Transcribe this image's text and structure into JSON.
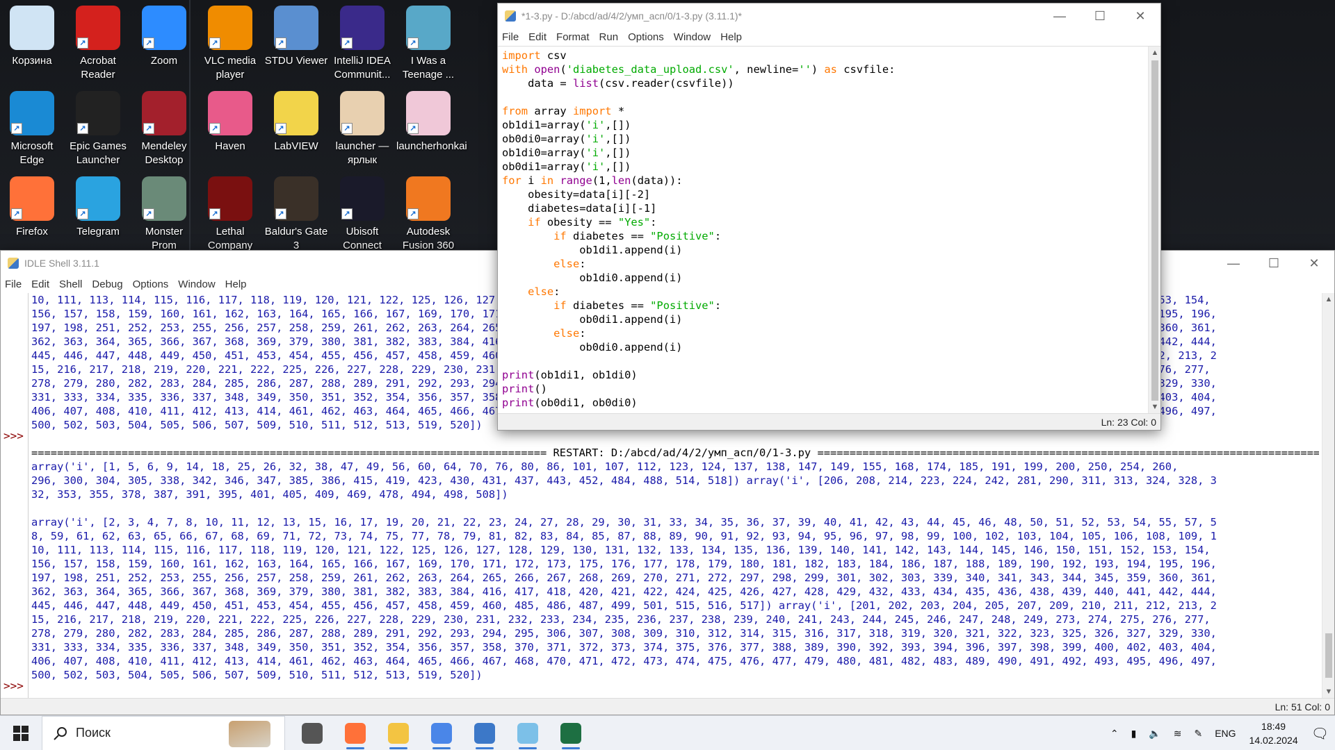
{
  "desktop": {
    "icons": [
      {
        "label": "Корзина",
        "icon": "recycle-bin-icon",
        "color": "#d0e4f4"
      },
      {
        "label": "Acrobat Reader",
        "icon": "acrobat-icon",
        "color": "#d4211d"
      },
      {
        "label": "Zoom",
        "icon": "zoom-icon",
        "color": "#2d8cff"
      },
      {
        "label": "VLC media player",
        "icon": "vlc-icon",
        "color": "#f08c00"
      },
      {
        "label": "STDU Viewer",
        "icon": "stdu-icon",
        "color": "#5a8fd0"
      },
      {
        "label": "IntelliJ IDEA Communit...",
        "icon": "intellij-icon",
        "color": "#3a2a8a"
      },
      {
        "label": "I Was a Teenage ...",
        "icon": "game-icon",
        "color": "#58a8c8"
      },
      {
        "label": "Microsoft Edge",
        "icon": "edge-icon",
        "color": "#1a8ad4"
      },
      {
        "label": "Epic Games Launcher",
        "icon": "epic-icon",
        "color": "#222222"
      },
      {
        "label": "Mendeley Desktop",
        "icon": "mendeley-icon",
        "color": "#a3202c"
      },
      {
        "label": "Haven",
        "icon": "haven-icon",
        "color": "#e85a8a"
      },
      {
        "label": "LabVIEW",
        "icon": "labview-icon",
        "color": "#f2d44a"
      },
      {
        "label": "launcher — ярлык",
        "icon": "genshin-icon",
        "color": "#e8d0b0"
      },
      {
        "label": "launcherhonkai",
        "icon": "honkai-icon",
        "color": "#f0c8d8"
      },
      {
        "label": "Firefox",
        "icon": "firefox-icon",
        "color": "#ff7139"
      },
      {
        "label": "Telegram",
        "icon": "telegram-icon",
        "color": "#2aa3e0"
      },
      {
        "label": "Monster Prom",
        "icon": "monster-prom-icon",
        "color": "#6a8a78"
      },
      {
        "label": "Lethal Company",
        "icon": "lethal-company-icon",
        "color": "#7a1010"
      },
      {
        "label": "Baldur's Gate 3",
        "icon": "baldurs-gate-icon",
        "color": "#3a3028"
      },
      {
        "label": "Ubisoft Connect",
        "icon": "ubisoft-icon",
        "color": "#1a1a2a"
      },
      {
        "label": "Autodesk Fusion 360",
        "icon": "fusion-icon",
        "color": "#f07820"
      }
    ]
  },
  "shell": {
    "title": "IDLE Shell 3.11.1",
    "menu": [
      "File",
      "Edit",
      "Shell",
      "Debug",
      "Options",
      "Window",
      "Help"
    ],
    "prompt": ">>>",
    "lines": [
      "10, 111, 113, 114, 115, 116, 117, 118, 119, 120, 121, 122, 125, 126, 127, 128, 129, 130, 131, 132, 133, 134, 135, 136, 139, 140, 141, 142, 143, 144, 145, 146, 150, 151, 152, 153, 154,",
      "156, 157, 158, 159, 160, 161, 162, 163, 164, 165, 166, 167, 169, 170, 171, 172, 173, 175, 176, 177, 178, 179, 180, 181, 182, 183, 184, 186, 187, 188, 189, 190, 192, 193, 194, 195, 196,",
      "197, 198, 251, 252, 253, 255, 256, 257, 258, 259, 261, 262, 263, 264, 265, 266, 267, 268, 269, 270, 271, 272, 297, 298, 299, 301, 302, 303, 339, 340, 341, 343, 344, 345, 359, 360, 361,",
      "362, 363, 364, 365, 366, 367, 368, 369, 379, 380, 381, 382, 383, 384, 416, 417, 418, 420, 421, 422, 424, 425, 426, 427, 428, 429, 432, 433, 434, 435, 436, 438, 439, 440, 441, 442, 444,",
      "445, 446, 447, 448, 449, 450, 451, 453, 454, 455, 456, 457, 458, 459, 460, 485, 486, 487, 499, 501, 515, 516, 517]) array('i', [201, 202, 203, 204, 205, 207, 209, 210, 211, 212, 213, 2",
      "15, 216, 217, 218, 219, 220, 221, 222, 225, 226, 227, 228, 229, 230, 231, 232, 233, 234, 235, 236, 237, 238, 239, 240, 241, 243, 244, 245, 246, 247, 248, 249, 273, 274, 275, 276, 277,",
      "278, 279, 280, 282, 283, 284, 285, 286, 287, 288, 289, 291, 292, 293, 294, 295, 306, 307, 308, 309, 310, 312, 314, 315, 316, 317, 318, 319, 320, 321, 322, 323, 325, 326, 327, 329, 330,",
      "331, 333, 334, 335, 336, 337, 348, 349, 350, 351, 352, 354, 356, 357, 358, 370, 371, 372, 373, 374, 375, 376, 377, 388, 389, 390, 392, 393, 394, 396, 397, 398, 399, 400, 402, 403, 404,",
      "406, 407, 408, 410, 411, 412, 413, 414, 461, 462, 463, 464, 465, 466, 467, 468, 470, 471, 472, 473, 474, 475, 476, 477, 479, 480, 481, 482, 483, 489, 490, 491, 492, 493, 495, 496, 497,",
      "500, 502, 503, 504, 505, 506, 507, 509, 510, 511, 512, 513, 519, 520])",
      "",
      "================================================================================ RESTART: D:/abcd/ad/4/2/умп_асп/0/1-3.py ================================================================================",
      "array('i', [1, 5, 6, 9, 14, 18, 25, 26, 32, 38, 47, 49, 56, 60, 64, 70, 76, 80, 86, 101, 107, 112, 123, 124, 137, 138, 147, 149, 155, 168, 174, 185, 191, 199, 200, 250, 254, 260,",
      "296, 300, 304, 305, 338, 342, 346, 347, 385, 386, 415, 419, 423, 430, 431, 437, 443, 452, 484, 488, 514, 518]) array('i', [206, 208, 214, 223, 224, 242, 281, 290, 311, 313, 324, 328, 3",
      "32, 353, 355, 378, 387, 391, 395, 401, 405, 409, 469, 478, 494, 498, 508])",
      "",
      "array('i', [2, 3, 4, 7, 8, 10, 11, 12, 13, 15, 16, 17, 19, 20, 21, 22, 23, 24, 27, 28, 29, 30, 31, 33, 34, 35, 36, 37, 39, 40, 41, 42, 43, 44, 45, 46, 48, 50, 51, 52, 53, 54, 55, 57, 5",
      "8, 59, 61, 62, 63, 65, 66, 67, 68, 69, 71, 72, 73, 74, 75, 77, 78, 79, 81, 82, 83, 84, 85, 87, 88, 89, 90, 91, 92, 93, 94, 95, 96, 97, 98, 99, 100, 102, 103, 104, 105, 106, 108, 109, 1",
      "10, 111, 113, 114, 115, 116, 117, 118, 119, 120, 121, 122, 125, 126, 127, 128, 129, 130, 131, 132, 133, 134, 135, 136, 139, 140, 141, 142, 143, 144, 145, 146, 150, 151, 152, 153, 154,",
      "156, 157, 158, 159, 160, 161, 162, 163, 164, 165, 166, 167, 169, 170, 171, 172, 173, 175, 176, 177, 178, 179, 180, 181, 182, 183, 184, 186, 187, 188, 189, 190, 192, 193, 194, 195, 196,",
      "197, 198, 251, 252, 253, 255, 256, 257, 258, 259, 261, 262, 263, 264, 265, 266, 267, 268, 269, 270, 271, 272, 297, 298, 299, 301, 302, 303, 339, 340, 341, 343, 344, 345, 359, 360, 361,",
      "362, 363, 364, 365, 366, 367, 368, 369, 379, 380, 381, 382, 383, 384, 416, 417, 418, 420, 421, 422, 424, 425, 426, 427, 428, 429, 432, 433, 434, 435, 436, 438, 439, 440, 441, 442, 444,",
      "445, 446, 447, 448, 449, 450, 451, 453, 454, 455, 456, 457, 458, 459, 460, 485, 486, 487, 499, 501, 515, 516, 517]) array('i', [201, 202, 203, 204, 205, 207, 209, 210, 211, 212, 213, 2",
      "15, 216, 217, 218, 219, 220, 221, 222, 225, 226, 227, 228, 229, 230, 231, 232, 233, 234, 235, 236, 237, 238, 239, 240, 241, 243, 244, 245, 246, 247, 248, 249, 273, 274, 275, 276, 277,",
      "278, 279, 280, 282, 283, 284, 285, 286, 287, 288, 289, 291, 292, 293, 294, 295, 306, 307, 308, 309, 310, 312, 314, 315, 316, 317, 318, 319, 320, 321, 322, 323, 325, 326, 327, 329, 330,",
      "331, 333, 334, 335, 336, 337, 348, 349, 350, 351, 352, 354, 356, 357, 358, 370, 371, 372, 373, 374, 375, 376, 377, 388, 389, 390, 392, 393, 394, 396, 397, 398, 399, 400, 402, 403, 404,",
      "406, 407, 408, 410, 411, 412, 413, 414, 461, 462, 463, 464, 465, 466, 467, 468, 470, 471, 472, 473, 474, 475, 476, 477, 479, 480, 481, 482, 483, 489, 490, 491, 492, 493, 495, 496, 497,",
      "500, 502, 503, 504, 505, 506, 507, 509, 510, 511, 512, 513, 519, 520])"
    ],
    "status": "Ln: 51   Col: 0"
  },
  "editor": {
    "title": "*1-3.py - D:/abcd/ad/4/2/умп_асп/0/1-3.py (3.11.1)*",
    "menu": [
      "File",
      "Edit",
      "Format",
      "Run",
      "Options",
      "Window",
      "Help"
    ],
    "code": [
      "import csv",
      "with open('diabetes_data_upload.csv', newline='') as csvfile:",
      "    data = list(csv.reader(csvfile))",
      "",
      "from array import *",
      "ob1di1=array('i',[])",
      "ob0di0=array('i',[])",
      "ob1di0=array('i',[])",
      "ob0di1=array('i',[])",
      "for i in range(1,len(data)):",
      "    obesity=data[i][-2]",
      "    diabetes=data[i][-1]",
      "    if obesity == \"Yes\":",
      "        if diabetes == \"Positive\":",
      "            ob1di1.append(i)",
      "        else:",
      "            ob1di0.append(i)",
      "    else:",
      "        if diabetes == \"Positive\":",
      "            ob0di1.append(i)",
      "        else:",
      "            ob0di0.append(i)",
      "",
      "print(ob1di1, ob1di0)",
      "print()",
      "print(ob0di1, ob0di0)"
    ],
    "status": "Ln: 23   Col: 0"
  },
  "taskbar": {
    "search_placeholder": "Поиск",
    "apps": [
      {
        "icon": "task-view-icon",
        "color": "#555555"
      },
      {
        "icon": "firefox-icon",
        "color": "#ff7139"
      },
      {
        "icon": "file-explorer-icon",
        "color": "#f3c442"
      },
      {
        "icon": "chrome-icon",
        "color": "#4a86e8"
      },
      {
        "icon": "python-idle-icon",
        "color": "#3c78c8"
      },
      {
        "icon": "paint-icon",
        "color": "#7cc0e8"
      },
      {
        "icon": "excel-icon",
        "color": "#1d6f42"
      }
    ],
    "language": "ENG",
    "time": "18:49",
    "date": "14.02.2024"
  }
}
